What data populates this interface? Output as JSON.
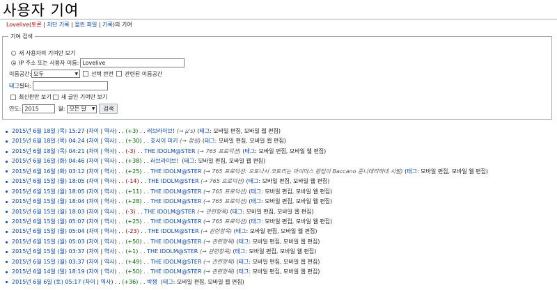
{
  "page": {
    "title": "사용자 기여",
    "subnav": {
      "user": "Lovelive",
      "talk": "토론",
      "block_log": "차단 기록",
      "uploads": "올린 파일",
      "logs": "기록",
      "suffix": "의 기여",
      "sep": " | "
    }
  },
  "form": {
    "legend": "기여 검색",
    "radio_new": "새 사용자의 기여만 보기",
    "radio_ip": "IP 주소 또는 사용자 이름:",
    "username_value": "Lovelive",
    "namespace_label": "이름공간:",
    "namespace_value": "모두",
    "invert_label": "선택 반전",
    "associated_label": "관련된 이름공간",
    "tag_filter_label": "태그",
    "tag_filter_suffix": " 필터:",
    "tag_filter_value": "",
    "latest_only_label": "최신판만 보기",
    "new_pages_label": "새 글인 기여만 보기",
    "year_label": "연도:",
    "year_value": "2015",
    "month_label": "월:",
    "month_value": "모든 달",
    "search_button": "검색"
  },
  "contributions": [
    {
      "date": "2015년 6월 18일 (목) 15:27",
      "diff": "차이",
      "hist": "역사",
      "size": "(+3)",
      "sign": "pos",
      "title": "러브라이브!",
      "comment": "(→ μ's)",
      "tags_label": "태그",
      "tags": ": 모바일 편집, 모바일 웹 편집)"
    },
    {
      "date": "2015년 6월 18일 (목) 04:24",
      "diff": "차이",
      "hist": "역사",
      "size": "(+30)",
      "sign": "pos",
      "title": "호시이 미키",
      "comment": "(→ 정설)",
      "tags_label": "태그",
      "tags": ": 모바일 편집, 모바일 웹 편집)"
    },
    {
      "date": "2015년 6월 18일 (목) 04:21",
      "diff": "차이",
      "hist": "역사",
      "size": "(-3)",
      "sign": "neg",
      "title": "THE IDOLM@STER",
      "comment": "(→ 765 프로덕션)",
      "tags_label": "태그",
      "tags": ": 모바일 편집, 모바일 웹 편집)"
    },
    {
      "date": "2015년 6월 16일 (화) 04:46",
      "diff": "차이",
      "hist": "역사",
      "size": "(+38)",
      "sign": "pos",
      "title": "러브라이브!",
      "comment": "",
      "tags_label": "태그",
      "tags": ": 모바일 편집, 모바일 웹 편집)"
    },
    {
      "date": "2015년 6월 16일 (화) 03:12",
      "diff": "차이",
      "hist": "역사",
      "size": "(+25)",
      "sign": "pos",
      "title": "THE IDOLM@STER",
      "comment": "(→ 765 프로덕션: 오토나시 코토리는 아이마스 왕팀이 Baccano 준니데리하네 시발)",
      "tags_label": "태그",
      "tags": ": 모바일 편집, 모바일 웹 편집)"
    },
    {
      "date": "2015년 6월 15일 (월) 18:05",
      "diff": "차이",
      "hist": "역사",
      "size": "(-14)",
      "sign": "neg",
      "title": "THE IDOLM@STER",
      "comment": "(→ 765 프로덕션)",
      "tags_label": "태그",
      "tags": ": 모바일 편집, 모바일 웹 편집)"
    },
    {
      "date": "2015년 6월 15일 (월) 18:05",
      "diff": "차이",
      "hist": "역사",
      "size": "(+11)",
      "sign": "pos",
      "title": "THE IDOLM@STER",
      "comment": "(→ 765 프로덕션)",
      "tags_label": "태그",
      "tags": ": 모바일 편집, 모바일 웹 편집)"
    },
    {
      "date": "2015년 6월 15일 (월) 18:04",
      "diff": "차이",
      "hist": "역사",
      "size": "(+28)",
      "sign": "pos",
      "title": "THE IDOLM@STER",
      "comment": "(→ 765 프로덕션)",
      "tags_label": "태그",
      "tags": ": 모바일 편집, 모바일 웹 편집)"
    },
    {
      "date": "2015년 6월 15일 (월) 18:03",
      "diff": "차이",
      "hist": "역사",
      "size": "(-3)",
      "sign": "neg",
      "title": "THE IDOLM@STER",
      "comment": "(→ 관련항목)",
      "tags_label": "태그",
      "tags": ": 모바일 편집, 모바일 웹 편집)"
    },
    {
      "date": "2015년 6월 15일 (월) 05:07",
      "diff": "차이",
      "hist": "역사",
      "size": "(+25)",
      "sign": "pos",
      "title": "THE IDOLM@STER",
      "comment": "(→ 765 프로덕션)",
      "tags_label": "태그",
      "tags": ": 모바일 편집, 모바일 웹 편집)"
    },
    {
      "date": "2015년 6월 15일 (월) 05:04",
      "diff": "차이",
      "hist": "역사",
      "size": "(-23)",
      "sign": "neg",
      "title": "THE IDOLM@STER",
      "comment": "(→ 관련항목)",
      "tags_label": "태그",
      "tags": ": 모바일 편집, 모바일 웹 편집)"
    },
    {
      "date": "2015년 6월 15일 (월) 05:03",
      "diff": "차이",
      "hist": "역사",
      "size": "(+50)",
      "sign": "pos",
      "title": "THE IDOLM@STER",
      "comment": "(→ 관련항목)",
      "tags_label": "태그",
      "tags": ": 모바일 편집, 모바일 웹 편집)"
    },
    {
      "date": "2015년 6월 15일 (월) 03:37",
      "diff": "차이",
      "hist": "역사",
      "size": "(+1)",
      "sign": "pos",
      "title": "THE IDOLM@STER",
      "comment": "(→ 관련항목)",
      "tags_label": "태그",
      "tags": ": 모바일 편집, 모바일 웹 편집)"
    },
    {
      "date": "2015년 6월 15일 (월) 03:37",
      "diff": "차이",
      "hist": "역사",
      "size": "(+49)",
      "sign": "pos",
      "title": "THE IDOLM@STER",
      "comment": "(→ 관련항목)",
      "tags_label": "태그",
      "tags": ": 모바일 편집, 모바일 웹 편집)"
    },
    {
      "date": "2015년 6월 14일 (일) 18:19",
      "diff": "차이",
      "hist": "역사",
      "size": "(+50)",
      "sign": "pos",
      "title": "THE IDOLM@STER",
      "comment": "(→ 관련항목)",
      "tags_label": "태그",
      "tags": ": 모바일 편집, 모바일 웹 편집)"
    },
    {
      "date": "2015년 6월 6일 (토) 05:17",
      "diff": "차이",
      "hist": "역사",
      "size": "(+36)",
      "sign": "pos",
      "title": "박쟁",
      "comment": "",
      "tags_label": "태그",
      "tags": ": 모바일 편집, 모바일 웹 편집)"
    }
  ]
}
